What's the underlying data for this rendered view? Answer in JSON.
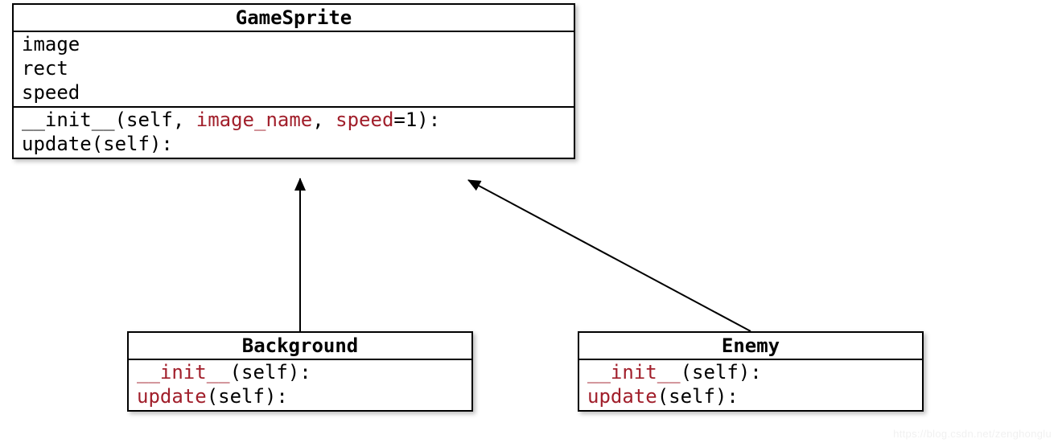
{
  "diagram": {
    "parent": {
      "name": "GameSprite",
      "attributes": [
        "image",
        "rect",
        "speed"
      ],
      "methods": {
        "init": {
          "name": "__init__",
          "params_open": "(self, ",
          "p1": "image_name",
          "sep": ", ",
          "p2": "speed",
          "tail": "=1):"
        },
        "update": {
          "raw": "update(self):"
        }
      }
    },
    "child1": {
      "name": "Background",
      "methods": {
        "init": {
          "raw_pre": "",
          "fn": "__init__",
          "raw_post": "(self):"
        },
        "update": {
          "raw_pre": "",
          "fn": "update",
          "raw_post": "(self):"
        }
      }
    },
    "child2": {
      "name": "Enemy",
      "methods": {
        "init": {
          "raw_pre": "",
          "fn": "__init__",
          "raw_post": "(self):"
        },
        "update": {
          "raw_pre": "",
          "fn": "update",
          "raw_post": "(self):"
        }
      }
    },
    "watermark": "https://blog.csdn.net/zenghonglu"
  }
}
